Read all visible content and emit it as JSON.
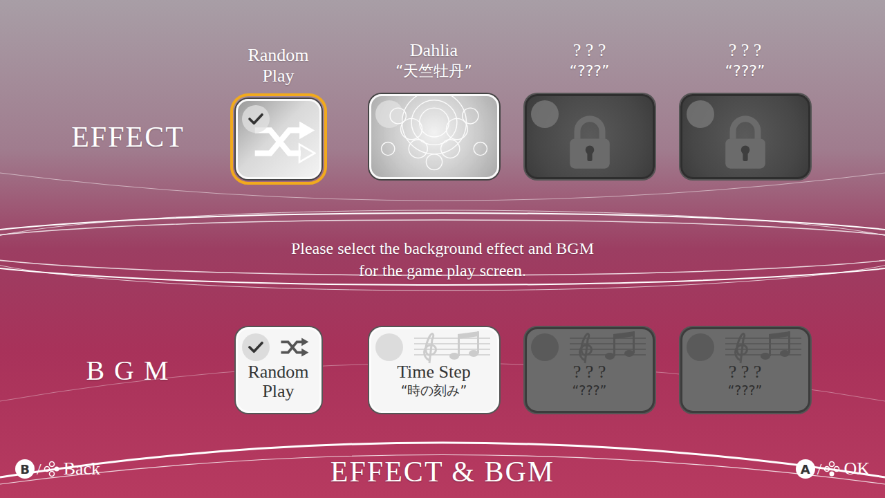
{
  "screen": {
    "title": "EFFECT & BGM",
    "instruction_lines": [
      "Please select the background effect and BGM",
      "for the game play screen."
    ]
  },
  "effect": {
    "label": "EFFECT",
    "items": [
      {
        "name": "Random Play",
        "subtitle": "",
        "kind": "random",
        "locked": false,
        "checked": true,
        "selected": true
      },
      {
        "name": "Dahlia",
        "subtitle": "“天竺牡丹”",
        "kind": "pattern",
        "locked": false,
        "checked": false,
        "selected": false
      },
      {
        "name": "? ? ?",
        "subtitle": "“???”",
        "kind": "pattern",
        "locked": true,
        "checked": false,
        "selected": false
      },
      {
        "name": "? ? ?",
        "subtitle": "“???”",
        "kind": "pattern",
        "locked": true,
        "checked": false,
        "selected": false
      }
    ]
  },
  "bgm": {
    "label": "B G M",
    "items": [
      {
        "name": "Random Play",
        "subtitle": "",
        "kind": "random",
        "locked": false,
        "checked": true,
        "selected": false
      },
      {
        "name": "Time Step",
        "subtitle": "“時の刻み”",
        "kind": "track",
        "locked": false,
        "checked": false,
        "selected": false
      },
      {
        "name": "? ? ?",
        "subtitle": "“???”",
        "kind": "track",
        "locked": true,
        "checked": false,
        "selected": false
      },
      {
        "name": "? ? ?",
        "subtitle": "“???”",
        "kind": "track",
        "locked": true,
        "checked": false,
        "selected": false
      }
    ]
  },
  "controls": [
    {
      "key": "B",
      "label": "Back",
      "slash": "/"
    },
    {
      "key": "A",
      "label": "OK",
      "slash": "/"
    }
  ]
}
